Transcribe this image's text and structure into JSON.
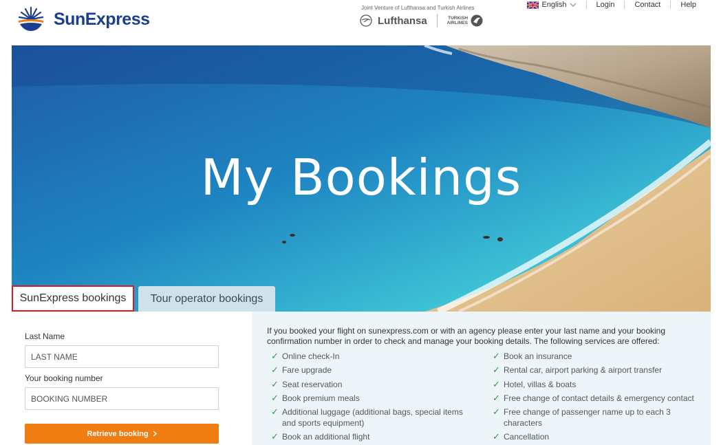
{
  "brand": {
    "name": "SunExpress"
  },
  "header": {
    "joint_venture": "Joint Venture of Lufthansa and Turkish Airlines",
    "partner1": "Lufthansa",
    "partner2_line1": "TURKISH",
    "partner2_line2": "AIRLINES"
  },
  "topnav": {
    "language": "English",
    "login": "Login",
    "contact": "Contact",
    "help": "Help"
  },
  "hero": {
    "title": "My Bookings"
  },
  "tabs": [
    {
      "label": "SunExpress bookings",
      "active": true
    },
    {
      "label": "Tour operator bookings",
      "active": false
    }
  ],
  "form": {
    "lastname_label": "Last Name",
    "lastname_placeholder": "LAST NAME",
    "booking_label": "Your booking number",
    "booking_placeholder": "BOOKING NUMBER",
    "submit_label": "Retrieve booking"
  },
  "info": {
    "intro": "If you booked your flight on sunexpress.com or with an agency please enter your last name and your booking confirmation number in order to check and manage your booking details. The following services are offered:",
    "services_left": [
      "Online check-In",
      "Fare upgrade",
      "Seat reservation",
      "Book premium meals",
      "Additional luggage (additional bags, special items and sports equipment)",
      "Book an additional flight"
    ],
    "services_right": [
      "Book an insurance",
      "Rental car, airport parking & airport transfer",
      "Hotel, villas & boats",
      "Free change of contact details & emergency contact",
      "Free change of passenger name up to each 3 characters",
      "Cancellation"
    ]
  },
  "colors": {
    "brand_blue": "#1a3f8f",
    "accent_orange": "#f07d12",
    "check_green": "#2e9b45",
    "tab_highlight": "#e01919"
  }
}
